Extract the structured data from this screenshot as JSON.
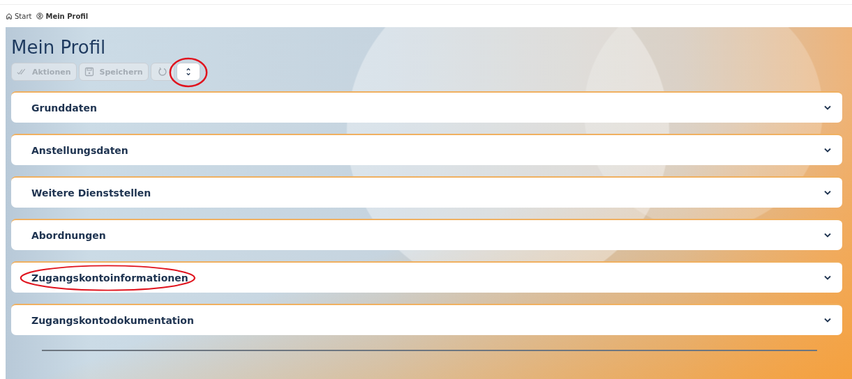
{
  "breadcrumb": [
    {
      "label": "Start",
      "kind": "home",
      "current": false
    },
    {
      "label": "Mein Profil",
      "kind": "profile",
      "current": true
    }
  ],
  "title": "Mein Profil",
  "toolbar": [
    {
      "kind": "actions",
      "label": "Aktionen",
      "disabled": true,
      "highlighted": false
    },
    {
      "kind": "save",
      "label": "Speichern",
      "disabled": true,
      "highlighted": false
    },
    {
      "kind": "reload",
      "disabled": true,
      "highlighted": false
    },
    {
      "kind": "expand",
      "disabled": false,
      "highlighted": true
    }
  ],
  "sections": [
    {
      "label": "Grunddaten",
      "expanded": false,
      "highlighted": false
    },
    {
      "label": "Anstellungsdaten",
      "expanded": false,
      "highlighted": false
    },
    {
      "label": "Weitere Dienststellen",
      "expanded": false,
      "highlighted": false
    },
    {
      "label": "Abordnungen",
      "expanded": false,
      "highlighted": false
    },
    {
      "label": "Zugangskontoinformationen",
      "expanded": false,
      "highlighted": true
    },
    {
      "label": "Zugangskontodokumentation",
      "expanded": false,
      "highlighted": false
    }
  ]
}
